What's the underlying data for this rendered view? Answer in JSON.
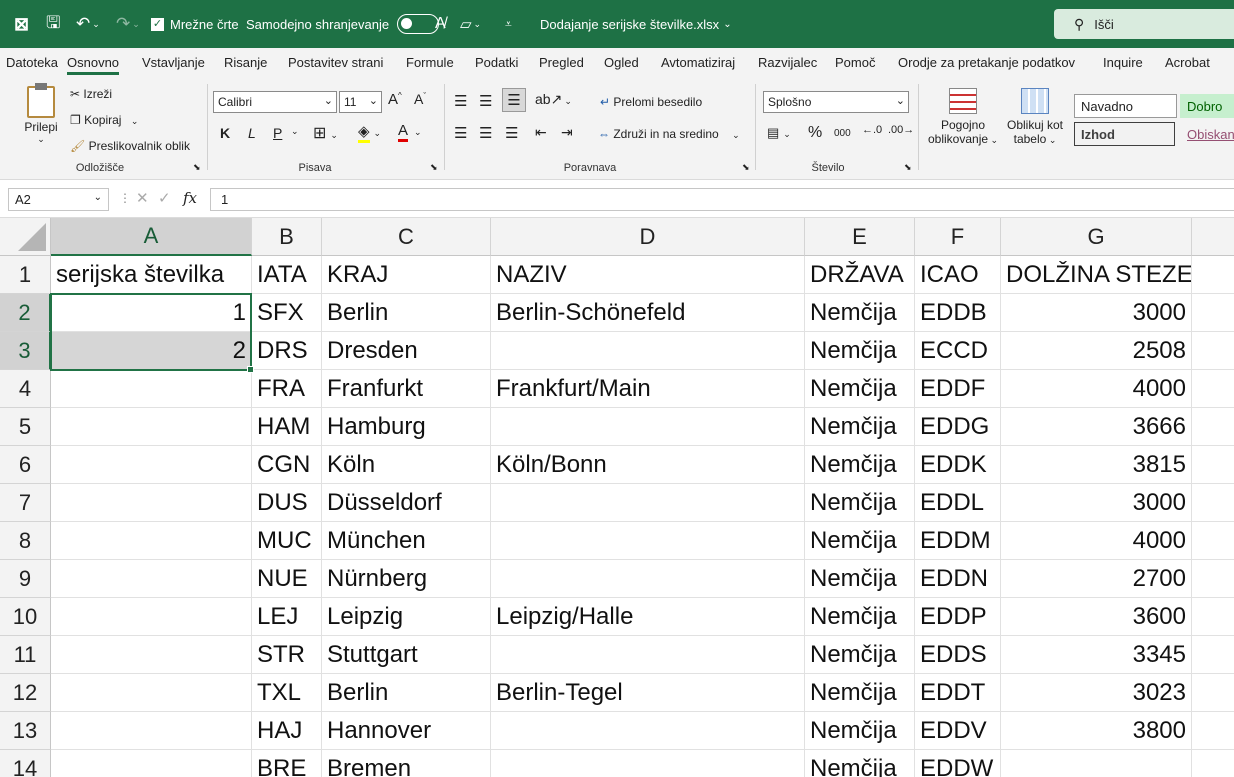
{
  "titlebar": {
    "autosave_label": "Samodejno shranjevanje",
    "gridlines_label": "Mrežne črte",
    "filename": "Dodajanje serijske številke.xlsx",
    "search_label": "Išči"
  },
  "menu": [
    "Datoteka",
    "Osnovno",
    "Vstavljanje",
    "Risanje",
    "Postavitev strani",
    "Formule",
    "Podatki",
    "Pregled",
    "Ogled",
    "Avtomatiziraj",
    "Razvijalec",
    "Pomoč",
    "Orodje za pretakanje podatkov",
    "Inquire",
    "Acrobat"
  ],
  "ribbon": {
    "clipboard": {
      "paste": "Prilepi",
      "cut": "Izreži",
      "copy": "Kopiraj",
      "format_painter": "Preslikovalnik oblik",
      "group": "Odložišče"
    },
    "font": {
      "name": "Calibri",
      "size": "11",
      "bold": "K",
      "italic": "L",
      "underline": "P",
      "group": "Pisava"
    },
    "alignment": {
      "wrap": "Prelomi besedilo",
      "merge": "Združi in na sredino",
      "group": "Poravnava"
    },
    "number": {
      "format": "Splošno",
      "percent": "%",
      "thousands": "000",
      "group": "Število"
    },
    "styles": {
      "conditional": "Pogojno",
      "conditional2": "oblikovanje",
      "table": "Oblikuj kot",
      "table2": "tabelo",
      "normal": "Navadno",
      "good": "Dobro",
      "output": "Izhod",
      "explanatory": "Obiskan"
    }
  },
  "formula_bar": {
    "name_box": "A2",
    "fx": "fx",
    "value": "1"
  },
  "columns": [
    "A",
    "B",
    "C",
    "D",
    "E",
    "F",
    "G"
  ],
  "rows": [
    [
      "serijska številka",
      "IATA",
      "KRAJ",
      "NAZIV",
      "DRŽAVA",
      "ICAO",
      "DOLŽINA STEZE"
    ],
    [
      "1",
      "SFX",
      "Berlin",
      "Berlin-Schönefeld",
      "Nemčija",
      "EDDB",
      "3000"
    ],
    [
      "2",
      "DRS",
      "Dresden",
      "",
      "Nemčija",
      "ECCD",
      "2508"
    ],
    [
      "",
      "FRA",
      "Franfurkt",
      "Frankfurt/Main",
      "Nemčija",
      "EDDF",
      "4000"
    ],
    [
      "",
      "HAM",
      "Hamburg",
      "",
      "Nemčija",
      "EDDG",
      "3666"
    ],
    [
      "",
      "CGN",
      "Köln",
      "Köln/Bonn",
      "Nemčija",
      "EDDK",
      "3815"
    ],
    [
      "",
      "DUS",
      "Düsseldorf",
      "",
      "Nemčija",
      "EDDL",
      "3000"
    ],
    [
      "",
      "MUC",
      "München",
      "",
      "Nemčija",
      "EDDM",
      "4000"
    ],
    [
      "",
      "NUE",
      "Nürnberg",
      "",
      "Nemčija",
      "EDDN",
      "2700"
    ],
    [
      "",
      "LEJ",
      "Leipzig",
      "Leipzig/Halle",
      "Nemčija",
      "EDDP",
      "3600"
    ],
    [
      "",
      "STR",
      "Stuttgart",
      "",
      "Nemčija",
      "EDDS",
      "3345"
    ],
    [
      "",
      "TXL",
      "Berlin",
      "Berlin-Tegel",
      "Nemčija",
      "EDDT",
      "3023"
    ],
    [
      "",
      "HAJ",
      "Hannover",
      "",
      "Nemčija",
      "EDDV",
      "3800"
    ],
    [
      "",
      "BRE",
      "Bremen",
      "",
      "Nemčija",
      "EDDW",
      ""
    ]
  ]
}
